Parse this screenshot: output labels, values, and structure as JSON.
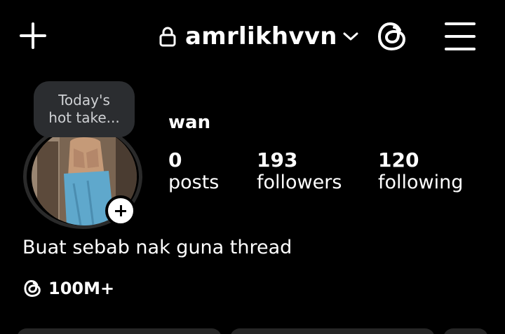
{
  "header": {
    "add_icon": "plus-icon",
    "lock_icon": "lock-icon",
    "username": "amrlikhvvn",
    "account_switcher_icon": "chevron-down-icon",
    "threads_icon": "threads-icon",
    "menu_icon": "hamburger-menu-icon"
  },
  "profile": {
    "note": "Today's\nhot take...",
    "display_name": "wan",
    "stats": [
      {
        "value": "0",
        "label": "posts"
      },
      {
        "value": "193",
        "label": "followers"
      },
      {
        "value": "120",
        "label": "following"
      }
    ],
    "bio": "Buat sebab nak guna thread",
    "threads_followers": "100M+"
  },
  "colors": {
    "background": "#000000",
    "text": "#ffffff",
    "note_bubble": "#2b2d30",
    "button": "#262626"
  }
}
